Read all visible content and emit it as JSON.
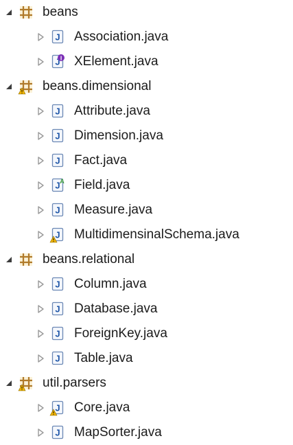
{
  "tree": [
    {
      "kind": "package",
      "label": "beans",
      "expanded": true,
      "warning": false,
      "icon": "package-icon"
    },
    {
      "kind": "file",
      "label": "Association.java",
      "icon": "java-class-icon"
    },
    {
      "kind": "file",
      "label": "XElement.java",
      "icon": "java-interface-icon"
    },
    {
      "kind": "package",
      "label": "beans.dimensional",
      "expanded": true,
      "warning": true,
      "icon": "package-warning-icon"
    },
    {
      "kind": "file",
      "label": "Attribute.java",
      "icon": "java-class-icon"
    },
    {
      "kind": "file",
      "label": "Dimension.java",
      "icon": "java-class-icon"
    },
    {
      "kind": "file",
      "label": "Fact.java",
      "icon": "java-class-icon"
    },
    {
      "kind": "file",
      "label": "Field.java",
      "icon": "java-abstract-class-icon"
    },
    {
      "kind": "file",
      "label": "Measure.java",
      "icon": "java-class-icon"
    },
    {
      "kind": "file",
      "label": "MultidimensinalSchema.java",
      "icon": "java-class-warning-icon"
    },
    {
      "kind": "package",
      "label": "beans.relational",
      "expanded": true,
      "warning": false,
      "icon": "package-icon"
    },
    {
      "kind": "file",
      "label": "Column.java",
      "icon": "java-class-icon"
    },
    {
      "kind": "file",
      "label": "Database.java",
      "icon": "java-class-icon"
    },
    {
      "kind": "file",
      "label": "ForeignKey.java",
      "icon": "java-class-icon"
    },
    {
      "kind": "file",
      "label": "Table.java",
      "icon": "java-class-icon"
    },
    {
      "kind": "package",
      "label": "util.parsers",
      "expanded": true,
      "warning": true,
      "icon": "package-warning-icon"
    },
    {
      "kind": "file",
      "label": "Core.java",
      "icon": "java-class-warning-icon"
    },
    {
      "kind": "file",
      "label": "MapSorter.java",
      "icon": "java-class-icon"
    }
  ],
  "colors": {
    "package": "#b07a2a",
    "package_fill": "#f3d68a",
    "java_border": "#6b88b5",
    "java_fill": "#f4f7fc",
    "java_letter": "#1f56a8",
    "warning": "#f0b400",
    "interface_letter": "#7b2fb6",
    "abstract_mark": "#3a9a3a",
    "twisty": "#9a9a9a",
    "twisty_expanded": "#3c3c3c"
  }
}
